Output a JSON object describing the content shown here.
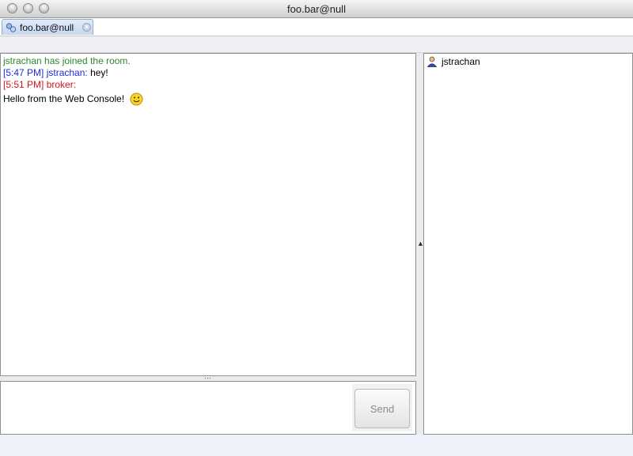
{
  "window": {
    "title": "foo.bar@null"
  },
  "tabs": [
    {
      "label": "foo.bar@null"
    }
  ],
  "chat": {
    "system_message": "jstrachan has joined the room.",
    "messages": [
      {
        "timestamp": "[5:47 PM]",
        "sender": "jstrachan:",
        "text": "hey!",
        "color": "#1f2bd8"
      },
      {
        "timestamp": "[5:51 PM]",
        "sender": "broker:",
        "text": "Hello from the Web Console!",
        "color": "#d41616",
        "emoticon": "smiley-icon"
      }
    ]
  },
  "input": {
    "value": "",
    "placeholder": ""
  },
  "send_button": {
    "label": "Send"
  },
  "roster": {
    "users": [
      {
        "name": "jstrachan",
        "icon": "user-icon"
      }
    ]
  },
  "colors": {
    "system": "#2a8a2a",
    "accent_blue": "#1f2bd8",
    "accent_red": "#d41616"
  }
}
